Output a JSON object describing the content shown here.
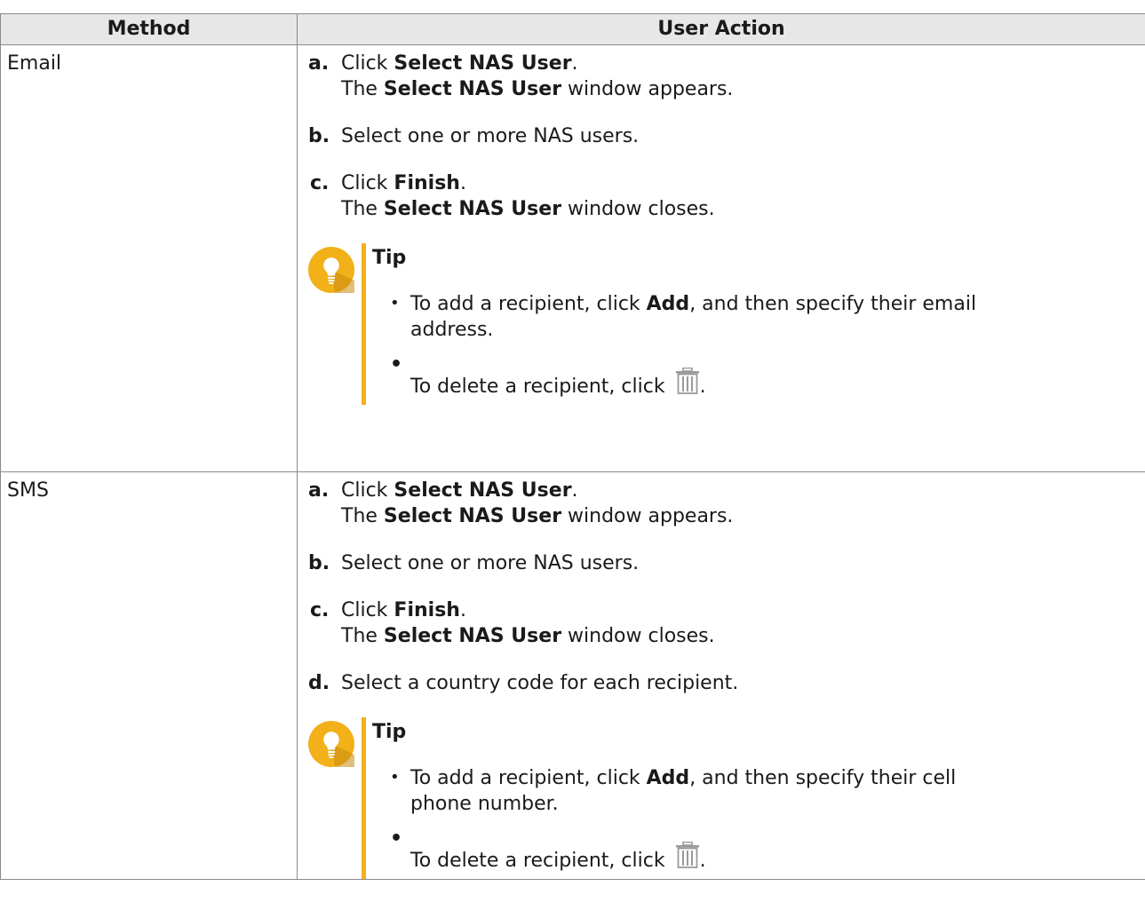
{
  "table": {
    "headers": {
      "method": "Method",
      "action": "User Action"
    },
    "rows": [
      {
        "method": "Email",
        "steps": [
          {
            "marker": "a.",
            "pre": "Click ",
            "bold": "Select NAS User",
            "post": ".",
            "line2_pre": "The ",
            "line2_bold": "Select NAS User",
            "line2_post": " window appears."
          },
          {
            "marker": "b.",
            "text": "Select one or more NAS users."
          },
          {
            "marker": "c.",
            "pre": "Click ",
            "bold": "Finish",
            "post": ".",
            "line2_pre": "The ",
            "line2_bold": "Select NAS User",
            "line2_post": " window closes."
          }
        ],
        "tip": {
          "title": "Tip",
          "add_pre": "To add a recipient, click ",
          "add_bold": "Add",
          "add_post": ", and then specify their email",
          "add_line2": "address.",
          "delete": "To delete a recipient, click ",
          "delete_post": "."
        }
      },
      {
        "method": "SMS",
        "steps": [
          {
            "marker": "a.",
            "pre": "Click ",
            "bold": "Select NAS User",
            "post": ".",
            "line2_pre": "The ",
            "line2_bold": "Select NAS User",
            "line2_post": " window appears."
          },
          {
            "marker": "b.",
            "text": "Select one or more NAS users."
          },
          {
            "marker": "c.",
            "pre": "Click ",
            "bold": "Finish",
            "post": ".",
            "line2_pre": "The ",
            "line2_bold": "Select NAS User",
            "line2_post": " window closes."
          },
          {
            "marker": "d.",
            "text": "Select a country code for each recipient."
          }
        ],
        "tip": {
          "title": "Tip",
          "add_pre": "To add a recipient, click ",
          "add_bold": "Add",
          "add_post": ", and then specify their cell",
          "add_line2": "phone number.",
          "delete": "To delete a recipient, click ",
          "delete_post": "."
        }
      }
    ]
  },
  "icons": {
    "tip": "lightbulb-icon",
    "delete": "trash-icon"
  },
  "colors": {
    "tip_accent": "#f5b01a",
    "tip_icon_bg": "#f2b019",
    "header_bg": "#e7e7e7",
    "border": "#8a8a8a"
  }
}
